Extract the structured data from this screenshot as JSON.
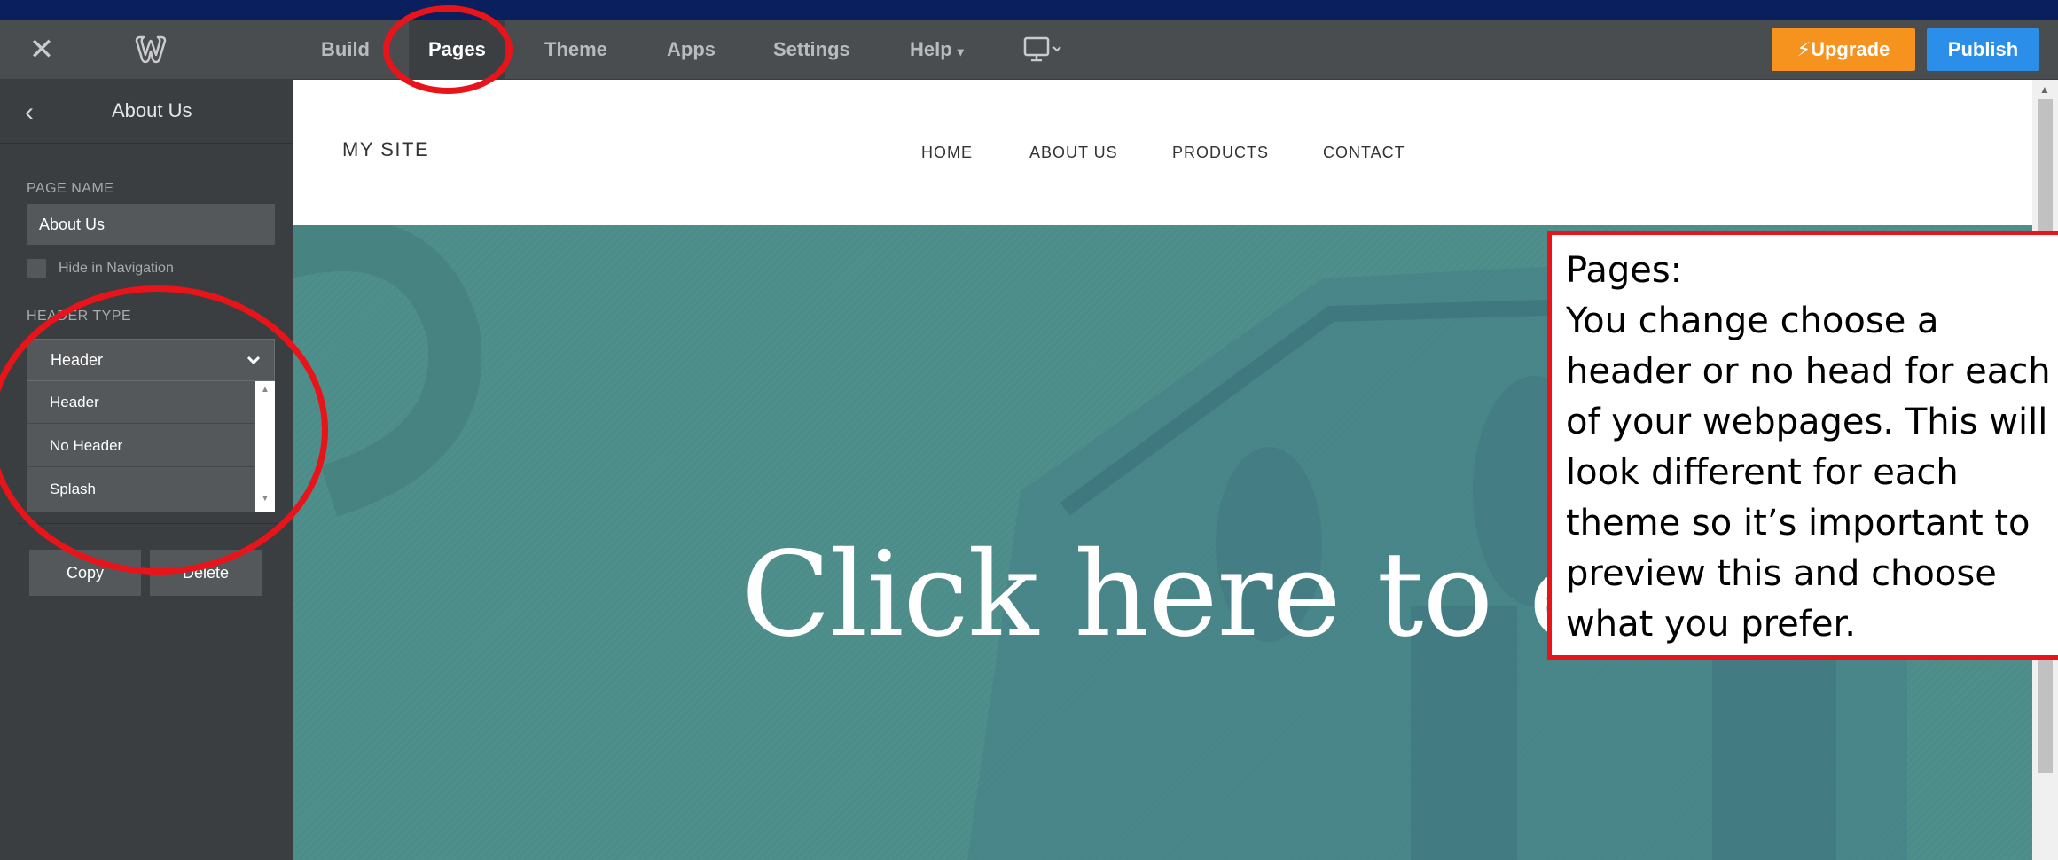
{
  "topbar": {
    "tabs": [
      {
        "label": "Build"
      },
      {
        "label": "Pages"
      },
      {
        "label": "Theme"
      },
      {
        "label": "Apps"
      },
      {
        "label": "Settings"
      },
      {
        "label": "Help"
      }
    ],
    "help_caret": "▾",
    "device_caret": "▾",
    "close_glyph": "✕",
    "upgrade_label": "Upgrade",
    "upgrade_icon": "⚡",
    "publish_label": "Publish",
    "active_tab": "Pages"
  },
  "sidebar": {
    "title": "About Us",
    "back_glyph": "‹",
    "page_name_label": "PAGE NAME",
    "page_name_value": "About Us",
    "hide_in_nav_label": "Hide in Navigation",
    "header_type_label": "HEADER TYPE",
    "header_type_selected": "Header",
    "header_type_options": [
      "Header",
      "No Header",
      "Splash"
    ],
    "copy_label": "Copy",
    "delete_label": "Delete"
  },
  "site": {
    "name": "MY SITE",
    "nav": [
      "HOME",
      "ABOUT US",
      "PRODUCTS",
      "CONTACT"
    ],
    "hero_text": "Click here to edit"
  },
  "callout": {
    "title": "Pages:",
    "body": "You change choose a header or no head for each of your webpages. This will look different for each theme so it’s important to preview this and choose what you prefer."
  },
  "colors": {
    "background": "#0a1f5e",
    "toolbar": "#4a4d50",
    "upgrade": "#f6921e",
    "publish": "#2b8ee8",
    "hero": "#4e8f8c",
    "annotation": "#e8141a"
  },
  "icons": {
    "logo": "weebly-w-icon",
    "device": "desktop-monitor-icon",
    "close": "close-icon",
    "back": "chevron-left-icon",
    "select": "chevron-down-icon"
  }
}
